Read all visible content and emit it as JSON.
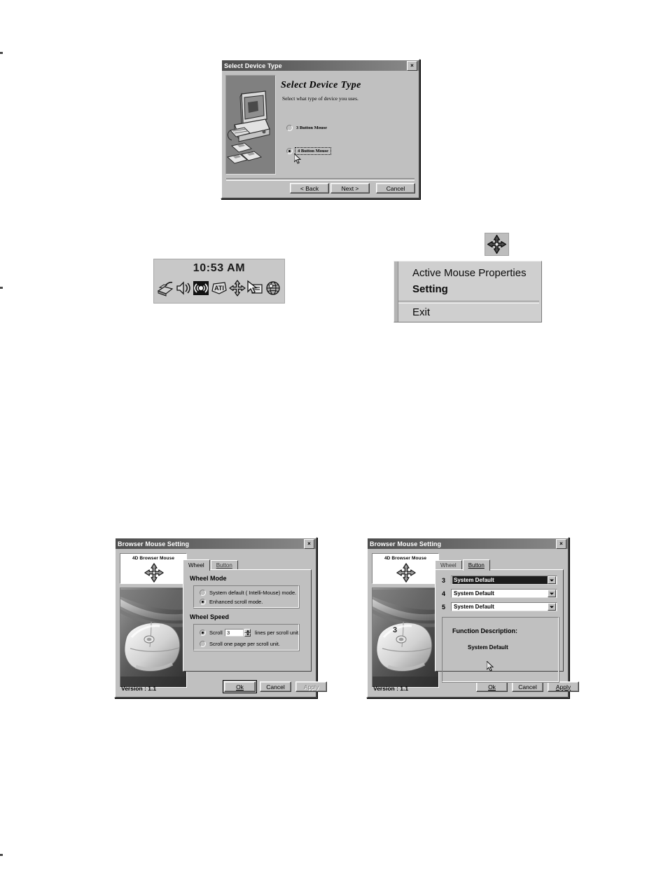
{
  "wizard": {
    "title": "Select Device Type",
    "close_label": "×",
    "heading": "Select Device Type",
    "subtitle": "Select what type of device you uses.",
    "options": [
      {
        "label": "3 Button Mouse",
        "selected": false
      },
      {
        "label": "4 Button Mouse",
        "selected": true
      }
    ],
    "buttons": {
      "back": "< Back",
      "next": "Next >",
      "cancel": "Cancel"
    }
  },
  "tray": {
    "clock": "10:53 AM",
    "icons": [
      "network-card-icon",
      "volume-speaker-icon",
      "wireless-signal-icon",
      "ati-graphics-icon",
      "four-way-arrow-mouse-icon",
      "display-cursor-icon",
      "globe-internet-icon"
    ]
  },
  "context_menu": {
    "tray_icon_name": "four-way-arrow-mouse-icon",
    "items": [
      {
        "label": "Active Mouse Properties",
        "bold": false
      },
      {
        "label": "Setting",
        "bold": true
      },
      {
        "label": "Exit",
        "bold": false
      }
    ]
  },
  "dialog_wheel": {
    "title": "Browser Mouse Setting",
    "close_label": "×",
    "logo_text": "4D Browser Mouse",
    "version": "Version : 1.1",
    "tabs": [
      {
        "label": "Wheel",
        "active": true
      },
      {
        "label": "Button",
        "active": false
      }
    ],
    "wheel_mode": {
      "group_label": "Wheel Mode",
      "options": [
        {
          "label": "System default ( Intelli-Mouse) mode.",
          "selected": false
        },
        {
          "label": "Enhanced scroll mode.",
          "selected": true
        }
      ]
    },
    "wheel_speed": {
      "group_label": "Wheel Speed",
      "scroll_prefix": "Scroll",
      "scroll_value": "3",
      "scroll_suffix": "lines per scroll unit.",
      "scroll_lines_selected": true,
      "page_option": "Scroll one page per scroll unit.",
      "page_option_selected": false
    },
    "buttons": {
      "ok": "Ok",
      "cancel": "Cancel",
      "apply": "Apply",
      "apply_disabled": true
    }
  },
  "dialog_button": {
    "title": "Browser Mouse Setting",
    "close_label": "×",
    "logo_text": "4D Browser Mouse",
    "version": "Version : 1.1",
    "mouse_photo_label": "3",
    "tabs": [
      {
        "label": "Wheel",
        "active": false
      },
      {
        "label": "Button",
        "active": true
      }
    ],
    "assignments": [
      {
        "number": "3",
        "value": "System Default",
        "selected": true
      },
      {
        "number": "4",
        "value": "System Default",
        "selected": false
      },
      {
        "number": "5",
        "value": "System Default",
        "selected": false
      }
    ],
    "function_description": {
      "title": "Function Description:",
      "value": "System Default"
    },
    "buttons": {
      "ok": "Ok",
      "cancel": "Cancel",
      "apply": "Apply",
      "apply_disabled": false
    }
  }
}
